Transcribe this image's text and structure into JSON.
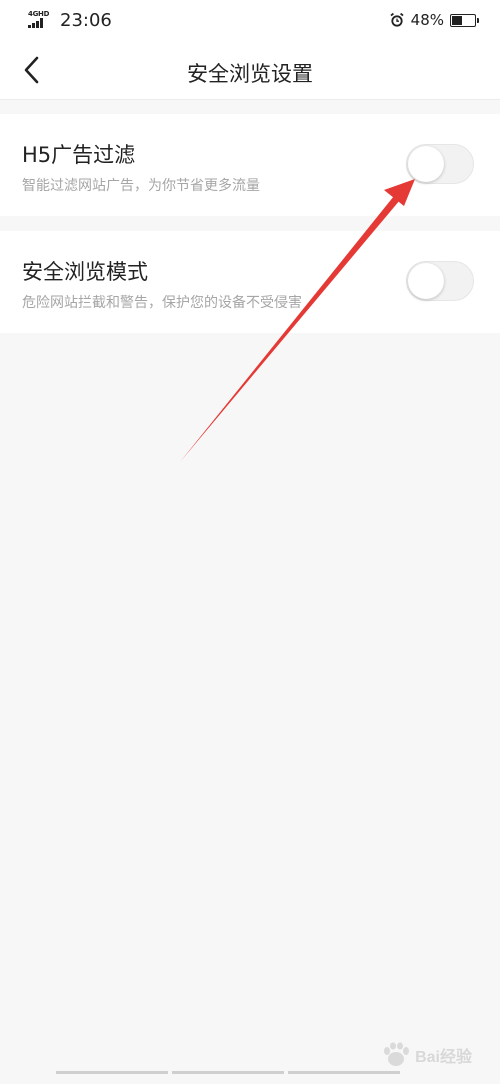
{
  "status_bar": {
    "network_label": "4GHD",
    "time": "23:06",
    "battery_text": "48%",
    "battery_level": 0.48,
    "icons": [
      "signal-icon",
      "alarm-icon",
      "battery-icon"
    ]
  },
  "nav": {
    "title": "安全浏览设置",
    "back_icon": "chevron-left-icon"
  },
  "settings": [
    {
      "title": "H5广告过滤",
      "description": "智能过滤网站广告，为你节省更多流量",
      "enabled": false
    },
    {
      "title": "安全浏览模式",
      "description": "危险网站拦截和警告，保护您的设备不受侵害",
      "enabled": false
    }
  ],
  "annotation": {
    "arrow_color": "#e53935"
  },
  "watermark": {
    "text": "Bai经验"
  },
  "colors": {
    "background": "#f7f7f7",
    "card": "#ffffff",
    "primary_text": "#222222",
    "secondary_text": "#a6a6a6",
    "toggle_off": "#f2f2f2"
  }
}
